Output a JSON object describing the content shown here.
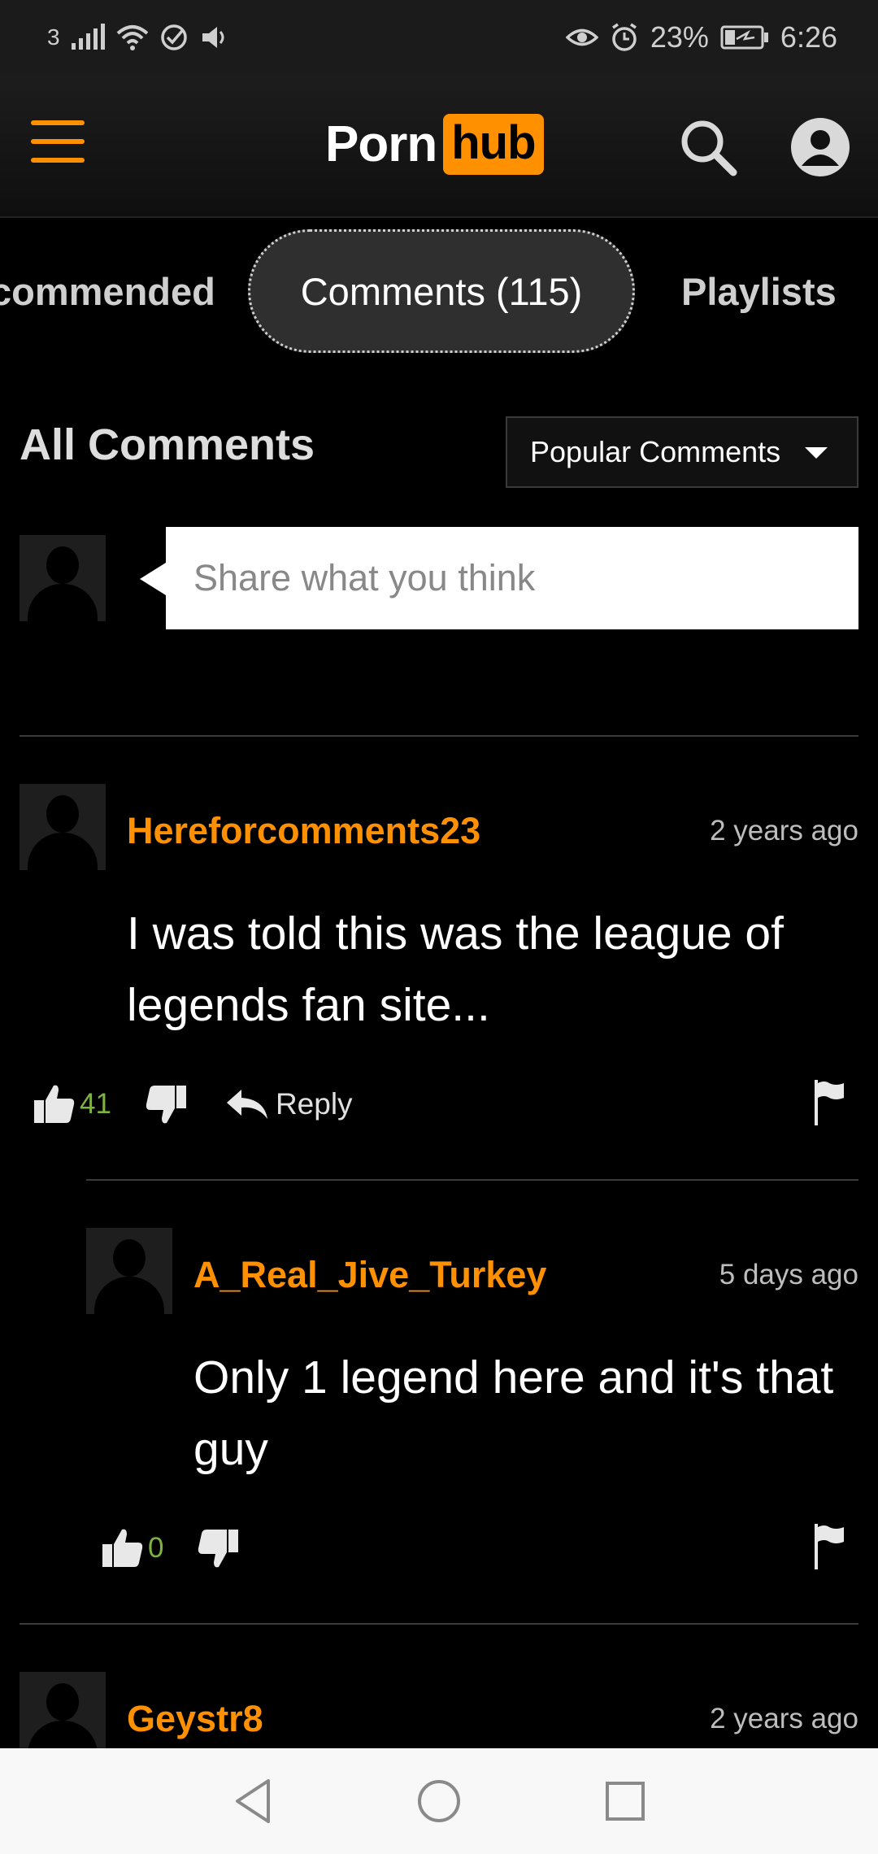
{
  "status": {
    "carrier": "3",
    "battery": "23%",
    "time": "6:26"
  },
  "header": {
    "logo_part1": "Porn",
    "logo_part2": "hub",
    "accent": "#ff9000"
  },
  "tabs": [
    {
      "label": "commended"
    },
    {
      "label": "Comments (115)",
      "active": true
    },
    {
      "label": "Playlists"
    }
  ],
  "comments_section": {
    "title": "All Comments",
    "sort_label": "Popular Comments",
    "share_placeholder": "Share what you think"
  },
  "comments": [
    {
      "username": "Hereforcomments23",
      "time": "2 years ago",
      "text": "I was told this was the league of legends fan site...",
      "likes": "41",
      "reply_label": "Reply"
    },
    {
      "username": "A_Real_Jive_Turkey",
      "time": "5 days ago",
      "text": "Only 1 legend here and it's that guy",
      "likes": "0"
    },
    {
      "username": "Geystr8",
      "time": "2 years ago"
    }
  ]
}
